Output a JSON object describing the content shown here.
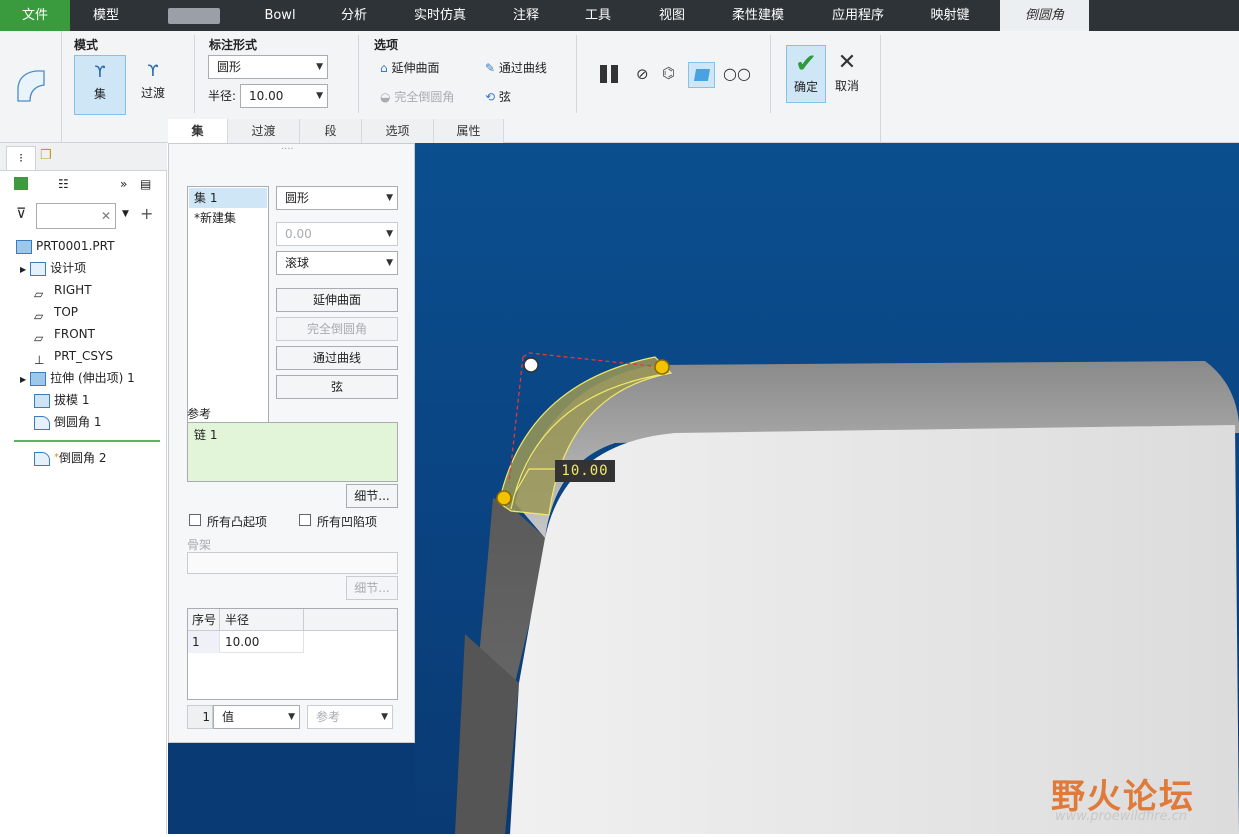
{
  "menubar": {
    "file": "文件",
    "items": [
      "模型",
      "",
      "Bowl",
      "分析",
      "实时仿真",
      "注释",
      "工具",
      "视图",
      "柔性建模",
      "应用程序",
      "映射键"
    ],
    "active": "倒圆角"
  },
  "ribbon": {
    "mode_label": "模式",
    "set_button": "集",
    "transition_button": "过渡",
    "dim_label": "标注形式",
    "dim_value": "圆形",
    "radius_label": "半径:",
    "radius_value": "10.00",
    "options_label": "选项",
    "opt_extend": "延伸曲面",
    "opt_full_round": "完全倒圆角",
    "opt_through_curve": "通过曲线",
    "opt_chord": "弦",
    "ok_label": "确定",
    "cancel_label": "取消",
    "tabs": [
      "集",
      "过渡",
      "段",
      "选项",
      "属性"
    ]
  },
  "tree": {
    "items": [
      "PRT0001.PRT",
      "设计项",
      "RIGHT",
      "TOP",
      "FRONT",
      "PRT_CSYS",
      "拉伸 (伸出项) 1",
      "拔模 1",
      "倒圆角 1",
      "倒圆角 2"
    ],
    "new_mark": "*"
  },
  "panel": {
    "sets": [
      "集 1",
      "*新建集"
    ],
    "shape_value": "圆形",
    "value_disabled": "0.00",
    "method_value": "滚球",
    "btn_extend": "延伸曲面",
    "btn_full_round": "完全倒圆角",
    "btn_through_curve": "通过曲线",
    "btn_chord": "弦",
    "ref_label": "参考",
    "ref_item": "链 1",
    "details_button": "细节...",
    "all_convex": "所有凸起项",
    "all_concave": "所有凹陷项",
    "skeleton_label": "骨架",
    "details_button2": "细节...",
    "table_headers": [
      "序号",
      "半径"
    ],
    "table_row": [
      "1",
      "10.00"
    ],
    "bottom_index": "1",
    "bottom_value": "值",
    "bottom_ref": "参考"
  },
  "viewport": {
    "dimension": "10.00",
    "watermark_title": "野火论坛",
    "watermark_url": "www.proewildfire.cn"
  }
}
